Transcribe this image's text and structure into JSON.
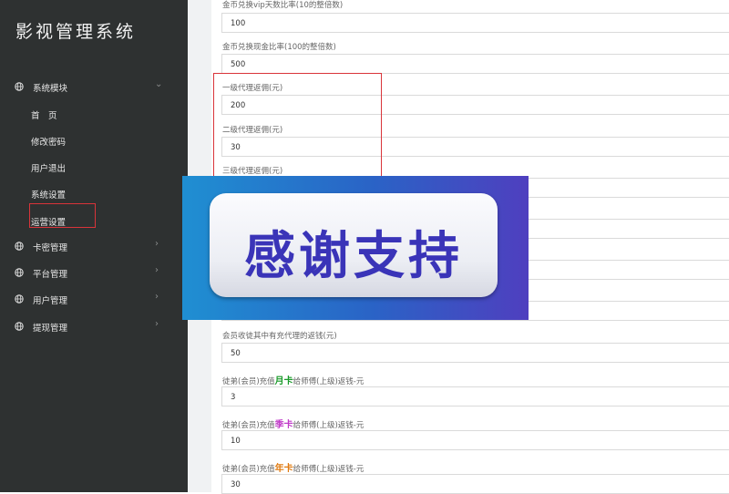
{
  "sidebar": {
    "title": "影视管理系统",
    "groups": [
      {
        "label": "系统模块",
        "icon": "globe-icon",
        "arrow": "⌄"
      },
      {
        "label": "卡密管理",
        "icon": "globe-icon",
        "arrow": "›"
      },
      {
        "label": "平台管理",
        "icon": "globe-icon",
        "arrow": "›"
      },
      {
        "label": "用户管理",
        "icon": "globe-icon",
        "arrow": "›"
      },
      {
        "label": "提现管理",
        "icon": "globe-icon",
        "arrow": "›"
      }
    ],
    "sub_items": [
      {
        "label": "首　页"
      },
      {
        "label": "修改密码"
      },
      {
        "label": "用户退出"
      },
      {
        "label": "系统设置"
      },
      {
        "label": "运营设置"
      }
    ]
  },
  "form": {
    "fields": [
      {
        "label": "金币兑换vip天数比率(10的整倍数)",
        "value": "100"
      },
      {
        "label": "金币兑换现金比率(100的整倍数)",
        "value": "500"
      },
      {
        "label": "一级代理返佣(元)",
        "value": "200"
      },
      {
        "label": "二级代理返佣(元)",
        "value": "30"
      },
      {
        "label": "三级代理返佣(元)",
        "value": ""
      },
      {
        "label": "会员收徒其中有充代理的返钱(元)",
        "value": "50"
      },
      {
        "label_pre": "徒弟(会员)充值",
        "label_hl": "月卡",
        "label_post": "给师傅(上级)返钱-元",
        "value": "3"
      },
      {
        "label_pre": "徒弟(会员)充值",
        "label_hl": "季卡",
        "label_post": "给师傅(上级)返钱-元",
        "value": "10"
      },
      {
        "label_pre": "徒弟(会员)充值",
        "label_hl": "年卡",
        "label_post": "给师傅(上级)返钱-元",
        "value": "30"
      }
    ]
  },
  "overlay": {
    "text": "感谢支持"
  },
  "colors": {
    "sidebar_bg": "#2e3131",
    "highlight_red": "#d9343a",
    "month_card": "#1a9a2a",
    "season_card": "#c03cc8",
    "year_card": "#e07a10",
    "banner_text": "#3a34b8"
  }
}
